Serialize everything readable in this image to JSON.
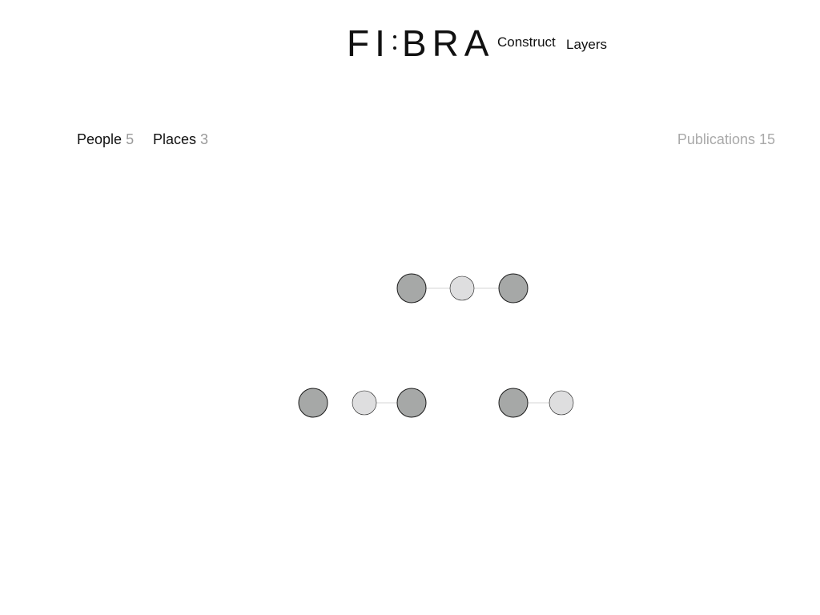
{
  "header": {
    "logo_left": "FI",
    "logo_right": "BRA",
    "nav": [
      {
        "label": "Construct"
      },
      {
        "label": "Layers"
      }
    ]
  },
  "filters": {
    "people": {
      "label": "People",
      "count": "5"
    },
    "places": {
      "label": "Places",
      "count": "3"
    },
    "publications": {
      "label": "Publications",
      "count": "15"
    }
  },
  "graph": {
    "colors": {
      "person": "#a6a8a7",
      "place": "#dededf",
      "edge": "#d4d4d4",
      "stroke": "#1a1a1a"
    },
    "clusters": [
      {
        "nodes": [
          "person",
          "place",
          "person"
        ],
        "edges": [
          [
            0,
            1
          ],
          [
            1,
            2
          ]
        ]
      },
      {
        "nodes": [
          "person"
        ],
        "edges": []
      },
      {
        "nodes": [
          "place",
          "person"
        ],
        "edges": [
          [
            0,
            1
          ]
        ]
      },
      {
        "nodes": [
          "person",
          "place"
        ],
        "edges": [
          [
            0,
            1
          ]
        ]
      }
    ]
  }
}
